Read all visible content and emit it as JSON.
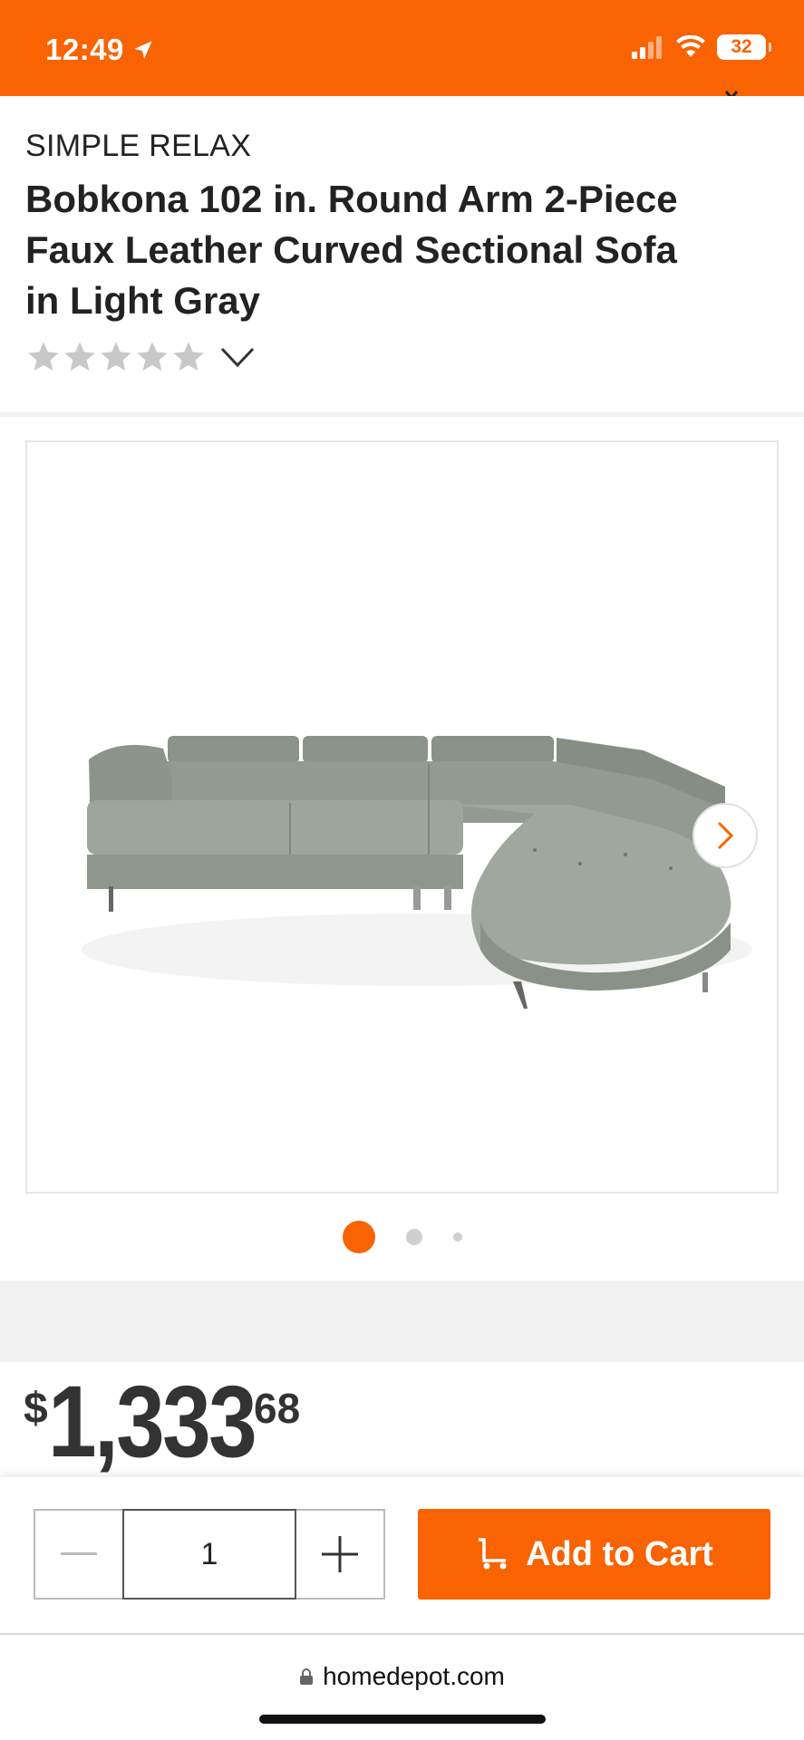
{
  "status_bar": {
    "time": "12:49",
    "battery": "32",
    "background_color": "#f96302"
  },
  "product": {
    "brand": "SIMPLE RELAX",
    "title": "Bobkona 102 in. Round Arm 2-Piece Faux Leather Curved Sectional Sofa in Light Gray",
    "rating_stars": 0,
    "rating_max": 5
  },
  "gallery": {
    "image_alt": "Light gray curved sectional sofa",
    "dots_count": 3,
    "active_dot": 1
  },
  "price": {
    "currency": "$",
    "dollars": "1,333",
    "cents": "68"
  },
  "cart": {
    "quantity": "1",
    "add_to_cart_label": "Add to Cart",
    "accent_color": "#f96302"
  },
  "browser": {
    "url": "homedepot.com"
  },
  "icons": [
    "location-arrow-icon",
    "signal-icon",
    "wifi-icon",
    "battery-icon",
    "chevron-down-icon",
    "chevron-right-icon",
    "minus-icon",
    "plus-icon",
    "cart-icon",
    "lock-icon"
  ]
}
